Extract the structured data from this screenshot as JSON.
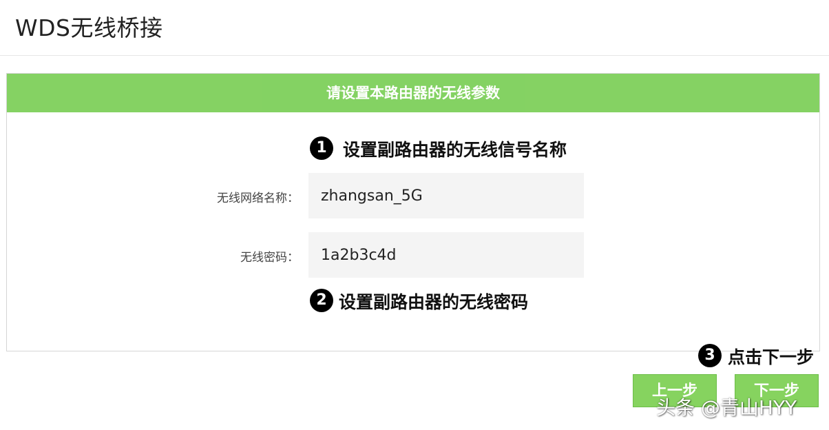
{
  "page": {
    "title": "WDS无线桥接"
  },
  "panel": {
    "header": "请设置本路由器的无线参数"
  },
  "annotations": {
    "step1": {
      "number": "1",
      "text": "设置副路由器的无线信号名称"
    },
    "step2": {
      "number": "2",
      "text": "设置副路由器的无线密码"
    },
    "step3": {
      "number": "3",
      "text": "点击下一步"
    }
  },
  "form": {
    "ssid_label": "无线网络名称：",
    "ssid_value": "zhangsan_5G",
    "password_label": "无线密码：",
    "password_value": "1a2b3c4d"
  },
  "buttons": {
    "prev": "上一步",
    "next": "下一步"
  },
  "watermark": "头条 @青山HYY",
  "colors": {
    "accent_green": "#7ed05b",
    "button_green": "#86d35f",
    "badge_black": "#000000"
  }
}
